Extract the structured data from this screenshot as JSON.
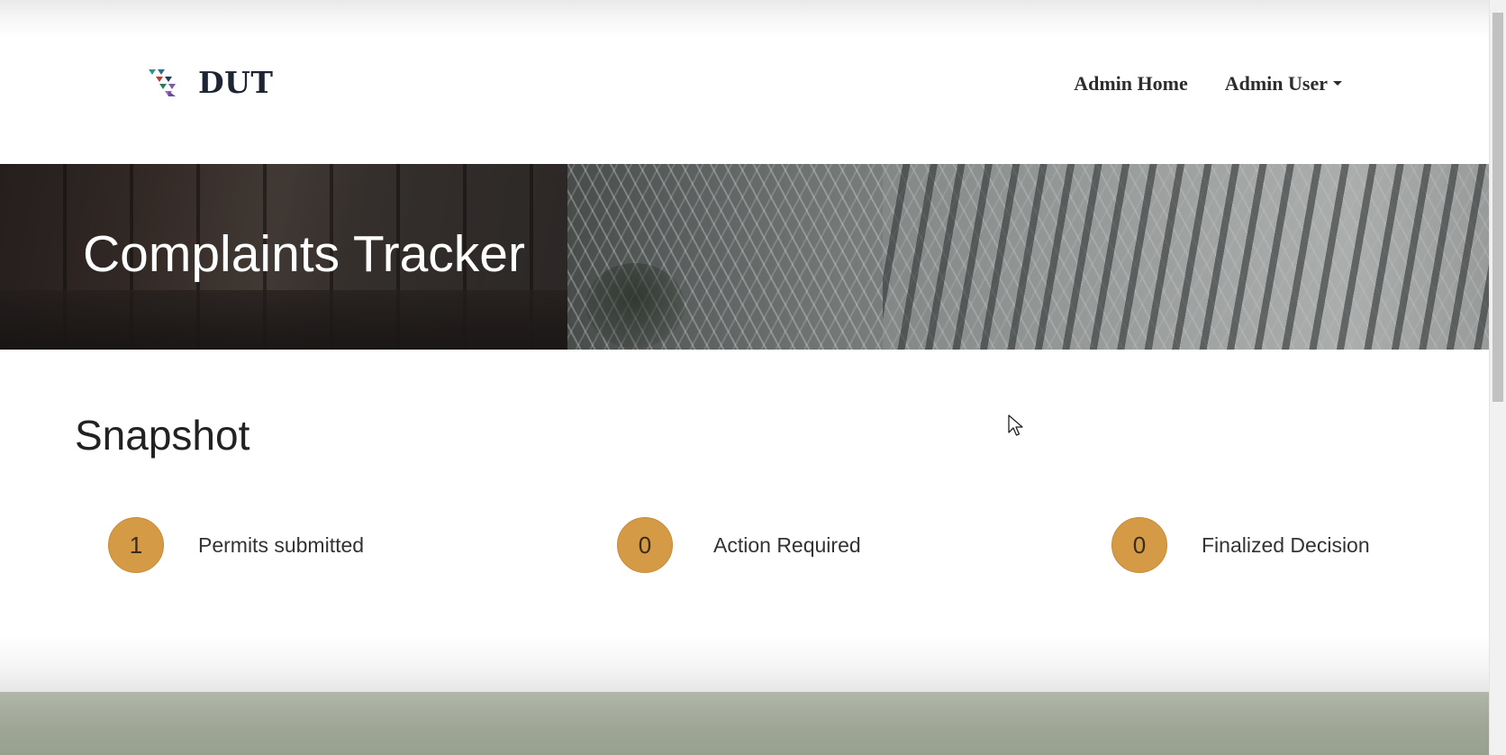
{
  "header": {
    "brand": "DUT",
    "nav": {
      "home_label": "Admin Home",
      "user_label": "Admin User"
    }
  },
  "hero": {
    "title": "Complaints Tracker"
  },
  "snapshot": {
    "title": "Snapshot",
    "stats": [
      {
        "value": "1",
        "label": "Permits submitted"
      },
      {
        "value": "0",
        "label": "Action Required"
      },
      {
        "value": "0",
        "label": "Finalized Decision"
      }
    ]
  },
  "colors": {
    "badge": "#d49a45",
    "brand_text": "#1d2433",
    "footer_band": "#a3aa9a"
  },
  "icons": {
    "logo": "dut-logo-icon",
    "user_menu": "caret-down-icon",
    "pointer": "mouse-cursor-icon"
  }
}
